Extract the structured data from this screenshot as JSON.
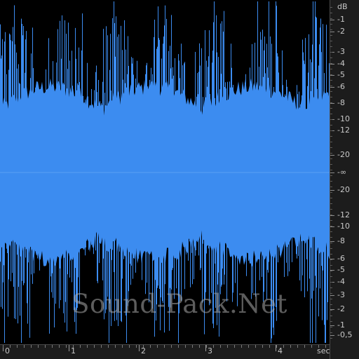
{
  "colors": {
    "background": "#000000",
    "waveform": "#3c8cf0",
    "ruler_bg": "#1c1c1c",
    "ruler_text": "#c8c8c8"
  },
  "db_ruler": {
    "unit_label": "dB",
    "labels": [
      "-1",
      "-2",
      "-3",
      "-4",
      "-5",
      "-6",
      "-8",
      "-10",
      "-12",
      "-20",
      "-∞",
      "-20",
      "-12",
      "-10",
      "-8",
      "-6",
      "-5",
      "-4",
      "-3",
      "-2",
      "-1",
      "-0,5"
    ]
  },
  "time_ruler": {
    "labels": [
      "0",
      "1",
      "2",
      "3",
      "4"
    ],
    "unit_label": "sec"
  },
  "watermark": "Sound-Pack.Net"
}
